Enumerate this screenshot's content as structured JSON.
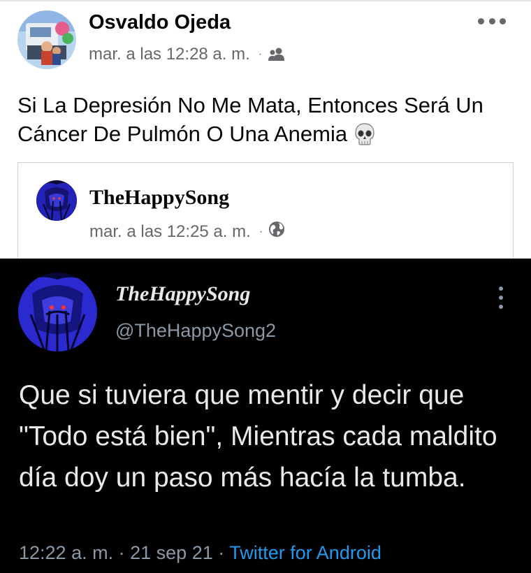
{
  "facebook_post": {
    "author": "Osvaldo Ojeda",
    "timestamp": "mar. a las 12:28 a. m.",
    "separator": "·",
    "audience_icon": "friends-icon",
    "more_icon": "more-horizontal-icon",
    "text": "Si La Depresión No Me Mata, Entonces Será Un Cáncer De Pulmón O Una Anemia",
    "emoji": "skull-emoji",
    "shared_post": {
      "author": "TheHappySong",
      "timestamp": "mar. a las 12:25 a. m.",
      "separator": "·",
      "audience_icon": "globe-icon"
    }
  },
  "tweet": {
    "display_name": "TheHappySong",
    "handle": "@TheHappySong2",
    "more_icon": "more-vertical-icon",
    "text": "Que si tuviera que mentir y decir que \"Todo está bien\", Mientras cada maldito día doy un paso más hacía la tumba.",
    "time": "12:22 a. m.",
    "date": "21 sep 21",
    "separator": "·",
    "source": "Twitter for Android"
  },
  "colors": {
    "facebook_secondary": "#65676b",
    "twitter_background": "#000000",
    "twitter_link": "#1d9bf0",
    "twitter_secondary": "#8b98a5"
  }
}
